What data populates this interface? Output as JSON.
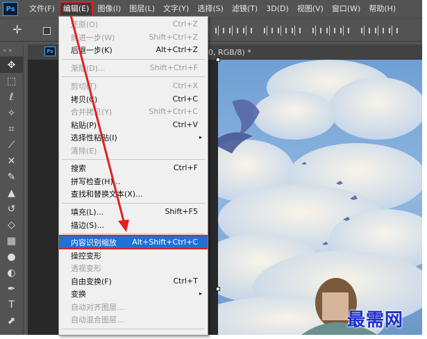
{
  "app": {
    "logo": "Ps",
    "doc_title_suffix": "0, RGB/8) *"
  },
  "menubar": {
    "items": [
      "文件(F)",
      "编辑(E)",
      "图像(I)",
      "图层(L)",
      "文字(Y)",
      "选择(S)",
      "滤镜(T)",
      "3D(D)",
      "视图(V)",
      "窗口(W)",
      "帮助(H)"
    ],
    "active_index": 1
  },
  "edit_menu": {
    "items": [
      {
        "label": "还原(O)",
        "shortcut": "Ctrl+Z",
        "disabled": true
      },
      {
        "label": "前进一步(W)",
        "shortcut": "Shift+Ctrl+Z",
        "disabled": true
      },
      {
        "label": "后退一步(K)",
        "shortcut": "Alt+Ctrl+Z",
        "disabled": false
      },
      {
        "label": "渐隐(D)...",
        "shortcut": "Shift+Ctrl+F",
        "disabled": true
      },
      {
        "label": "剪切(T)",
        "shortcut": "Ctrl+X",
        "disabled": true
      },
      {
        "label": "拷贝(C)",
        "shortcut": "Ctrl+C",
        "disabled": false
      },
      {
        "label": "合并拷贝(Y)",
        "shortcut": "Shift+Ctrl+C",
        "disabled": true
      },
      {
        "label": "粘贴(P)",
        "shortcut": "Ctrl+V",
        "disabled": false
      },
      {
        "label": "选择性粘贴(I)",
        "shortcut": "",
        "disabled": false,
        "submenu": true
      },
      {
        "label": "清除(E)",
        "shortcut": "",
        "disabled": true
      },
      {
        "label": "搜索",
        "shortcut": "Ctrl+F",
        "disabled": false
      },
      {
        "label": "拼写检查(H)...",
        "shortcut": "",
        "disabled": false
      },
      {
        "label": "查找和替换文本(X)...",
        "shortcut": "",
        "disabled": false
      },
      {
        "label": "填充(L)...",
        "shortcut": "Shift+F5",
        "disabled": false
      },
      {
        "label": "描边(S)...",
        "shortcut": "",
        "disabled": false
      },
      {
        "label": "内容识别缩放",
        "shortcut": "Alt+Shift+Ctrl+C",
        "disabled": false,
        "highlighted": true
      },
      {
        "label": "操控变形",
        "shortcut": "",
        "disabled": false
      },
      {
        "label": "透视变形",
        "shortcut": "",
        "disabled": true
      },
      {
        "label": "自由变换(F)",
        "shortcut": "Ctrl+T",
        "disabled": false
      },
      {
        "label": "变换",
        "shortcut": "",
        "disabled": false,
        "submenu": true
      },
      {
        "label": "自动对齐图层...",
        "shortcut": "",
        "disabled": true
      },
      {
        "label": "自动混合图层...",
        "shortcut": "",
        "disabled": true
      }
    ]
  },
  "watermark": "最需网",
  "colors": {
    "highlight": "#1e71d6",
    "annotation": "#e02020",
    "ps_blue": "#31a8ff"
  },
  "icons": {
    "arrow": "▸",
    "move": "✛"
  }
}
